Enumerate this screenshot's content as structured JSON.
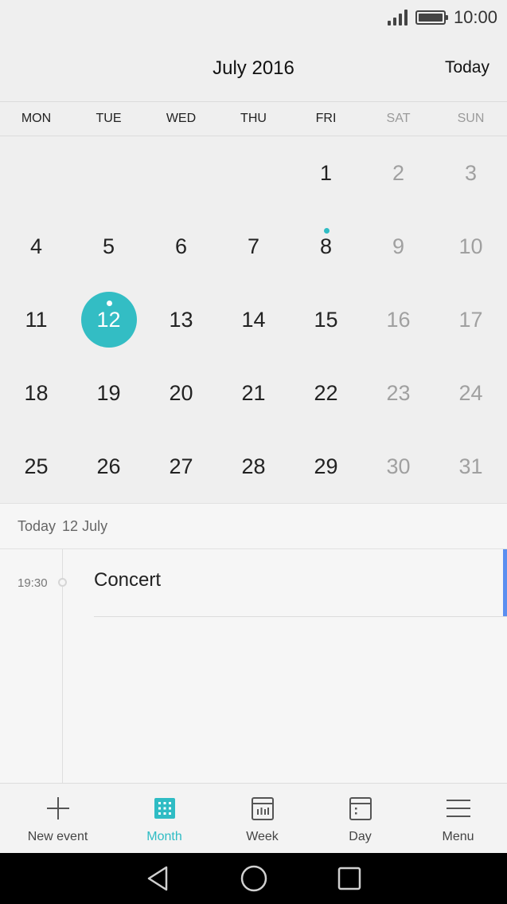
{
  "status": {
    "time": "10:00",
    "signal_icon": "signal-icon",
    "battery_icon": "battery-icon"
  },
  "header": {
    "title": "July 2016",
    "today_button": "Today"
  },
  "weekdays": [
    "MON",
    "TUE",
    "WED",
    "THU",
    "FRI",
    "SAT",
    "SUN"
  ],
  "calendar": {
    "weeks": [
      [
        "",
        "",
        "",
        "",
        "1",
        "2",
        "3"
      ],
      [
        "4",
        "5",
        "6",
        "7",
        "8",
        "9",
        "10"
      ],
      [
        "11",
        "12",
        "13",
        "14",
        "15",
        "16",
        "17"
      ],
      [
        "18",
        "19",
        "20",
        "21",
        "22",
        "23",
        "24"
      ],
      [
        "25",
        "26",
        "27",
        "28",
        "29",
        "30",
        "31"
      ]
    ],
    "selected_day": "12",
    "event_days": [
      "8",
      "12"
    ],
    "accent_color": "#33bdc4"
  },
  "agenda": {
    "heading_today": "Today",
    "heading_date": "12 July",
    "events": [
      {
        "time": "19:30",
        "title": "Concert",
        "color": "#5b8ff0"
      }
    ]
  },
  "toolbar": {
    "new_event": "New event",
    "month": "Month",
    "week": "Week",
    "day": "Day",
    "menu": "Menu",
    "active": "Month"
  },
  "navigation": {
    "back_icon": "back-icon",
    "home_icon": "home-icon",
    "recents_icon": "recents-icon"
  }
}
